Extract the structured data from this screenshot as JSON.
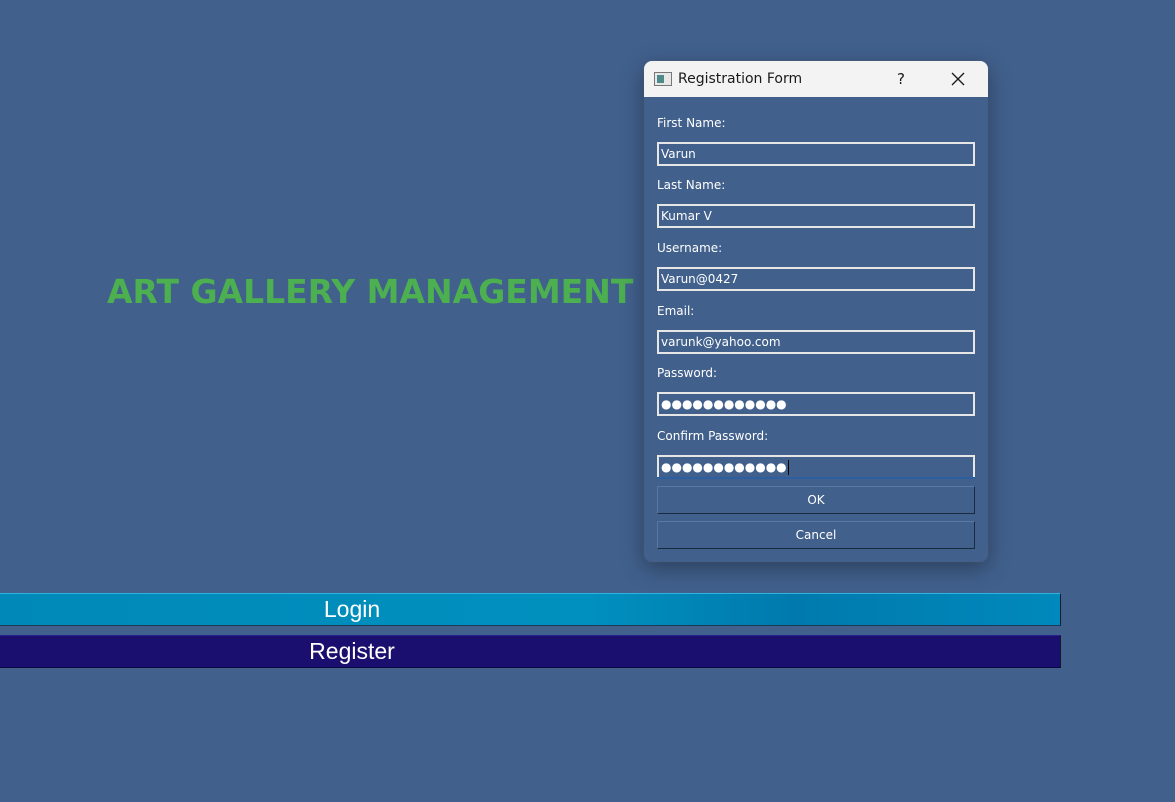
{
  "app": {
    "title": "ART GALLERY MANAGEMENT",
    "login_label": "Login",
    "register_label": "Register"
  },
  "dialog": {
    "title": "Registration Form",
    "help_label": "?",
    "fields": [
      {
        "label": "First Name:",
        "value": "Varun"
      },
      {
        "label": "Last Name:",
        "value": "Kumar V"
      },
      {
        "label": "Username:",
        "value": "Varun@0427"
      },
      {
        "label": "Email:",
        "value": "varunk@yahoo.com"
      },
      {
        "label": "Password:",
        "value": "●●●●●●●●●●●●"
      },
      {
        "label": "Confirm Password:",
        "value": "●●●●●●●●●●●●"
      }
    ],
    "ok_label": "OK",
    "cancel_label": "Cancel"
  },
  "colors": {
    "background": "#41608c",
    "title_green": "#4caf50",
    "login_button": "#008bbd",
    "register_button": "#1a0f6e"
  },
  "icons": {
    "window_icon": "window-icon",
    "close_icon": "close-icon"
  }
}
